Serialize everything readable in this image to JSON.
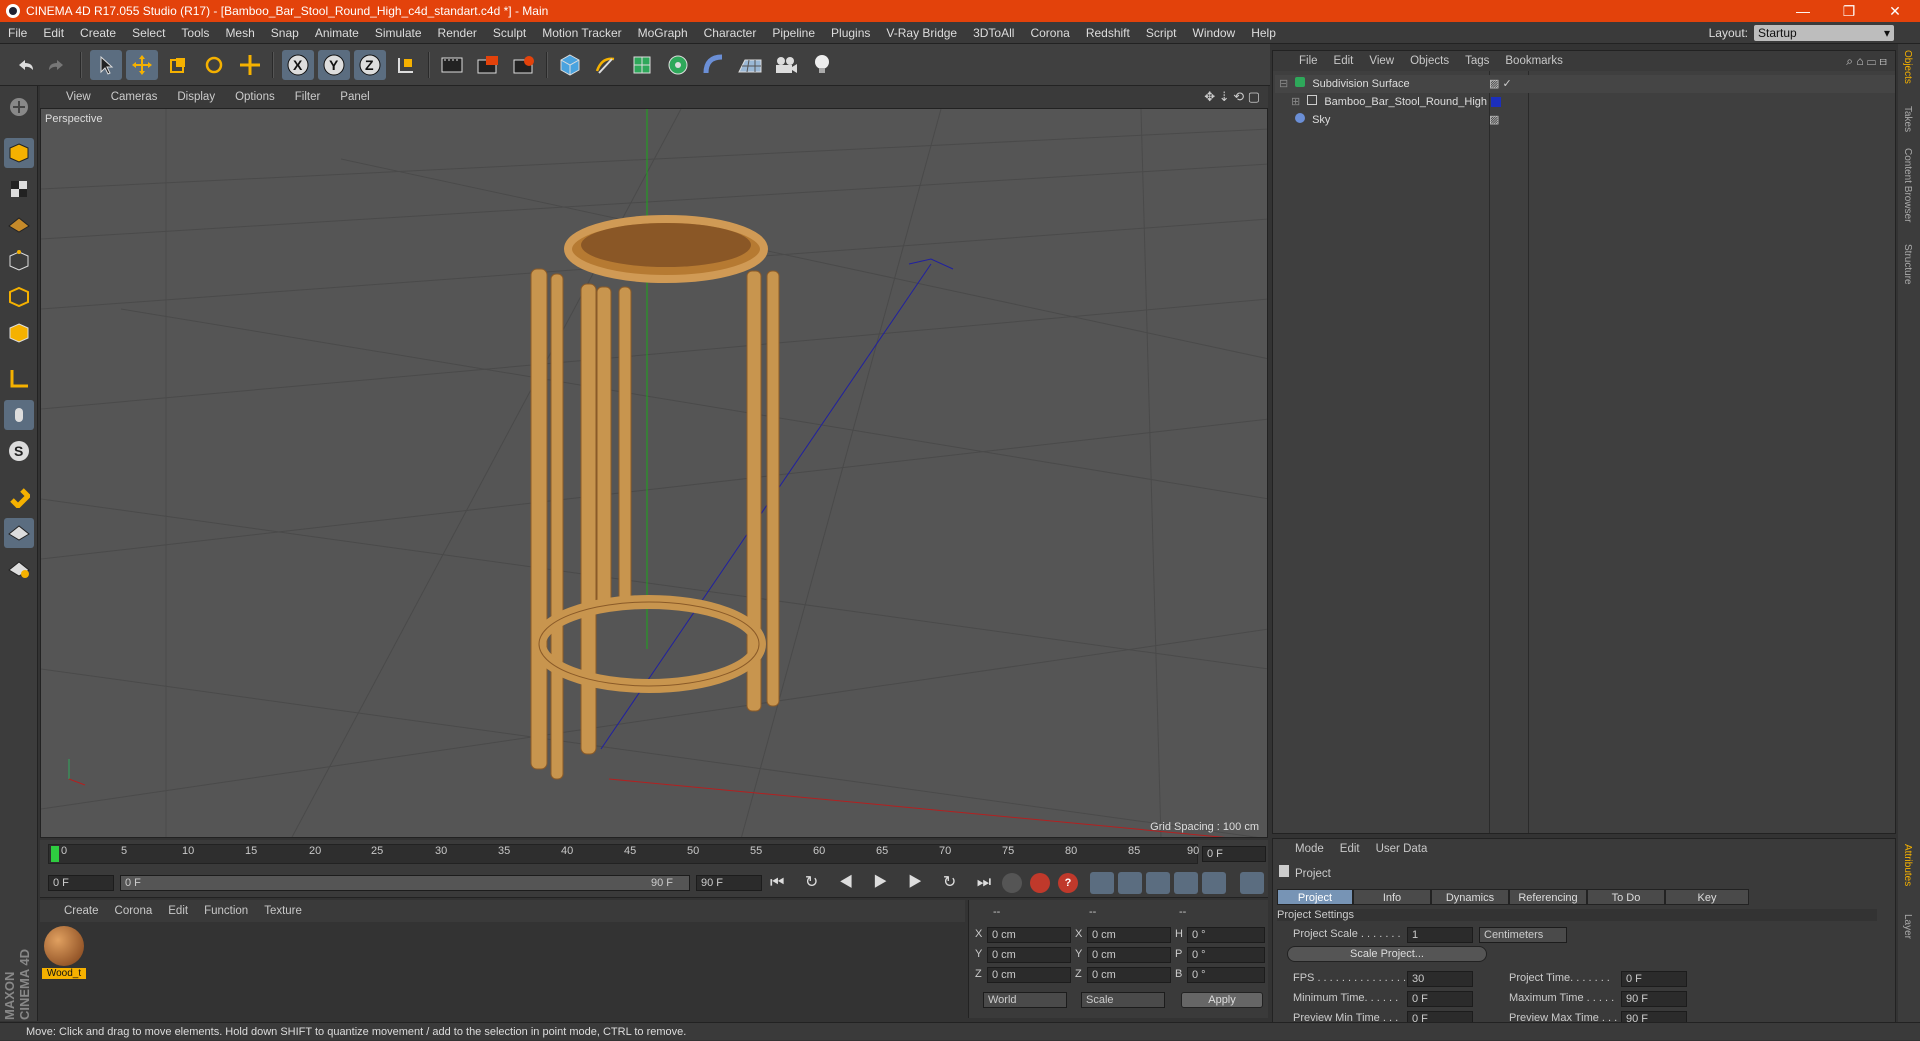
{
  "window": {
    "title": "CINEMA 4D R17.055 Studio (R17) - [Bamboo_Bar_Stool_Round_High_c4d_standart.c4d *] - Main",
    "minimize": "—",
    "restore": "❐",
    "close": "✕"
  },
  "menubar": {
    "items": [
      "File",
      "Edit",
      "Create",
      "Select",
      "Tools",
      "Mesh",
      "Snap",
      "Animate",
      "Simulate",
      "Render",
      "Sculpt",
      "Motion Tracker",
      "MoGraph",
      "Character",
      "Pipeline",
      "Plugins",
      "V-Ray Bridge",
      "3DToAll",
      "Corona",
      "Redshift",
      "Script",
      "Window",
      "Help"
    ],
    "layout_label": "Layout:",
    "layout_value": "Startup"
  },
  "viewport": {
    "menu": [
      "View",
      "Cameras",
      "Display",
      "Options",
      "Filter",
      "Panel"
    ],
    "label": "Perspective",
    "grid_spacing": "Grid Spacing : 100 cm"
  },
  "timeline": {
    "ticks": [
      "0",
      "5",
      "10",
      "15",
      "20",
      "25",
      "30",
      "35",
      "40",
      "45",
      "50",
      "55",
      "60",
      "65",
      "70",
      "75",
      "80",
      "85",
      "90"
    ],
    "end_frame": "0 F",
    "start_field": "0 F",
    "range_start": "0 F",
    "range_end": "90 F",
    "max_field": "90 F"
  },
  "material_manager": {
    "menu": [
      "Create",
      "Corona",
      "Edit",
      "Function",
      "Texture"
    ],
    "material_name": "Wood_t"
  },
  "coordinates": {
    "header": [
      "--",
      "--",
      "--"
    ],
    "rows": [
      {
        "a": "X",
        "av": "0 cm",
        "b": "X",
        "bv": "0 cm",
        "c": "H",
        "cv": "0 °"
      },
      {
        "a": "Y",
        "av": "0 cm",
        "b": "Y",
        "bv": "0 cm",
        "c": "P",
        "cv": "0 °"
      },
      {
        "a": "Z",
        "av": "0 cm",
        "b": "Z",
        "bv": "0 cm",
        "c": "B",
        "cv": "0 °"
      }
    ],
    "world": "World",
    "scale": "Scale",
    "apply": "Apply"
  },
  "object_manager": {
    "menu": [
      "File",
      "Edit",
      "View",
      "Objects",
      "Tags",
      "Bookmarks"
    ],
    "objects": [
      "Subdivision Surface",
      "Bamboo_Bar_Stool_Round_High",
      "Sky"
    ]
  },
  "right_tabs": [
    "Objects",
    "Takes",
    "Content Browser",
    "Structure",
    "Attributes",
    "Layer"
  ],
  "attributes": {
    "menu": [
      "Mode",
      "Edit",
      "User Data"
    ],
    "title": "Project",
    "tabs": [
      "Project Settings",
      "Info",
      "Dynamics",
      "Referencing",
      "To Do",
      "Key Interpolation"
    ],
    "section": "Project Settings",
    "project_scale_label": "Project Scale . . . . . . .",
    "project_scale_value": "1",
    "project_scale_unit": "Centimeters",
    "scale_project_btn": "Scale Project...",
    "fps_label": "FPS . . . . . . . . . . . . . . .",
    "fps_value": "30",
    "project_time_label": "Project Time. . . . . . .",
    "project_time_value": "0 F",
    "min_time_label": "Minimum Time. . . . . .",
    "min_time_value": "0 F",
    "max_time_label": "Maximum Time . . . . .",
    "max_time_value": "90 F",
    "prev_min_label": "Preview Min Time . . .",
    "prev_min_value": "0 F",
    "prev_max_label": "Preview Max Time . . .",
    "prev_max_value": "90 F"
  },
  "status": "Move: Click and drag to move elements. Hold down SHIFT to quantize movement / add to the selection in point mode, CTRL to remove.",
  "brand": "MAXON CINEMA 4D"
}
